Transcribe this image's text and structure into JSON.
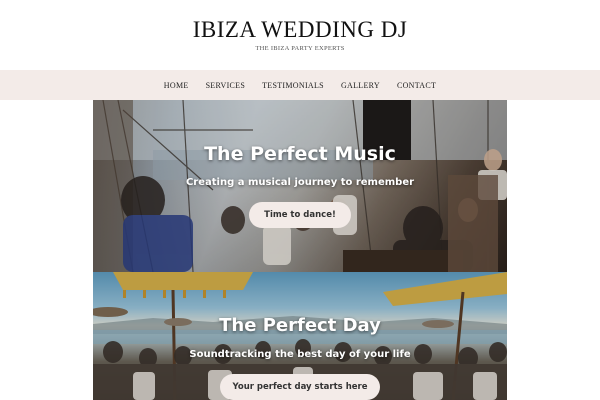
{
  "header": {
    "title": "IBIZA WEDDING DJ",
    "tagline": "THE IBIZA PARTY EXPERTS"
  },
  "nav": {
    "items": [
      {
        "label": "HOME"
      },
      {
        "label": "SERVICES"
      },
      {
        "label": "TESTIMONIALS"
      },
      {
        "label": "GALLERY"
      },
      {
        "label": "CONTACT"
      }
    ]
  },
  "panels": {
    "music": {
      "title": "The Perfect Music",
      "subtitle": "Creating a musical journey to remember",
      "button": "Time to dance!"
    },
    "day": {
      "title": "The Perfect Day",
      "subtitle": "Soundtracking the best day of your life",
      "button": "Your perfect day starts here"
    }
  },
  "colors": {
    "nav_bg": "#f3ebe8",
    "button_bg": "#f3ebe8",
    "title_text": "#111111"
  }
}
